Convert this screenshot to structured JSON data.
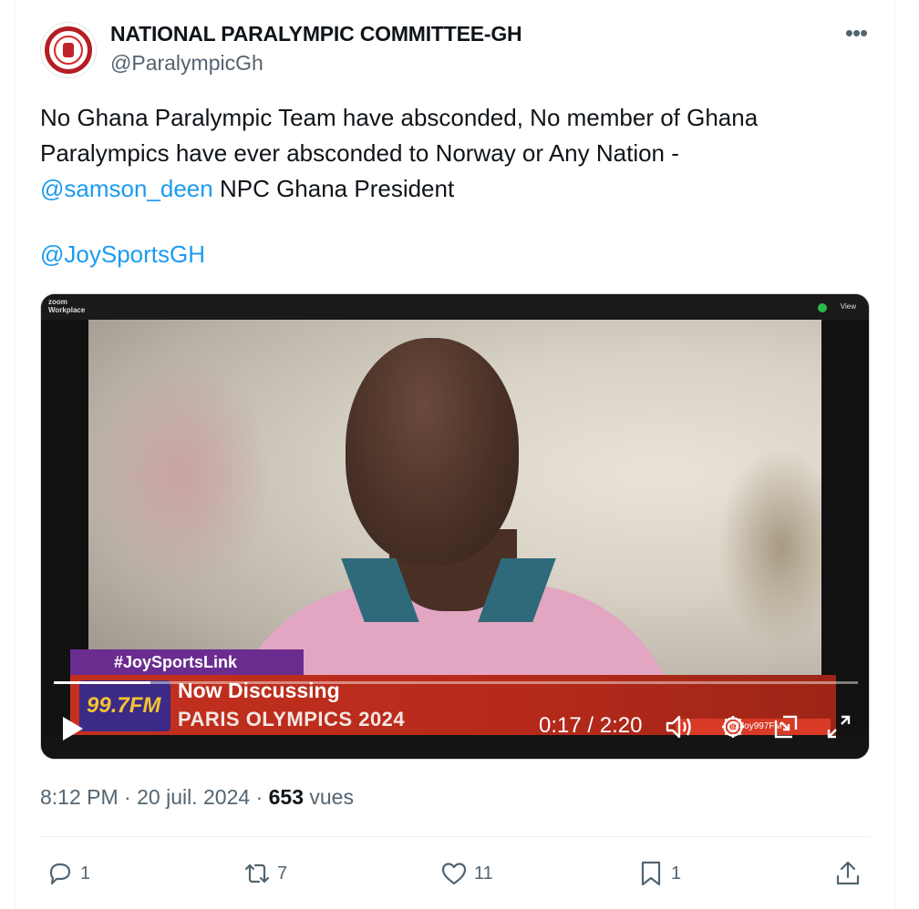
{
  "account": {
    "display_name": "NATIONAL PARALYMPIC COMMITTEE-GH",
    "handle": "@ParalympicGh"
  },
  "tweet": {
    "text_part1": "No Ghana Paralympic Team have absconded, No member of Ghana Paralympics have ever absconded to Norway or Any Nation -",
    "mention1": "@samson_deen",
    "text_part2": " NPC Ghana President",
    "mention2": "@JoySportsGH"
  },
  "video": {
    "zoom_label_line1": "zoom",
    "zoom_label_line2": "Workplace",
    "view_label": "View",
    "hashtag_banner": "#JoySportsLink",
    "logo_text": "99.7FM",
    "lower_third_title": "Now Discussing",
    "lower_third_subtitle": "PARIS OLYMPICS 2024",
    "social_handle": "@Joy997FM",
    "time_display": "0:17 / 2:20",
    "progress_fraction": 0.12
  },
  "meta": {
    "time": "8:12 PM",
    "date": "20 juil. 2024",
    "views_count": "653",
    "views_label": "vues",
    "separator": "·"
  },
  "actions": {
    "replies": "1",
    "reposts": "7",
    "likes": "11",
    "bookmarks": "1"
  },
  "colors": {
    "link": "#1d9bf0",
    "text": "#0f1419",
    "muted": "#536471"
  }
}
